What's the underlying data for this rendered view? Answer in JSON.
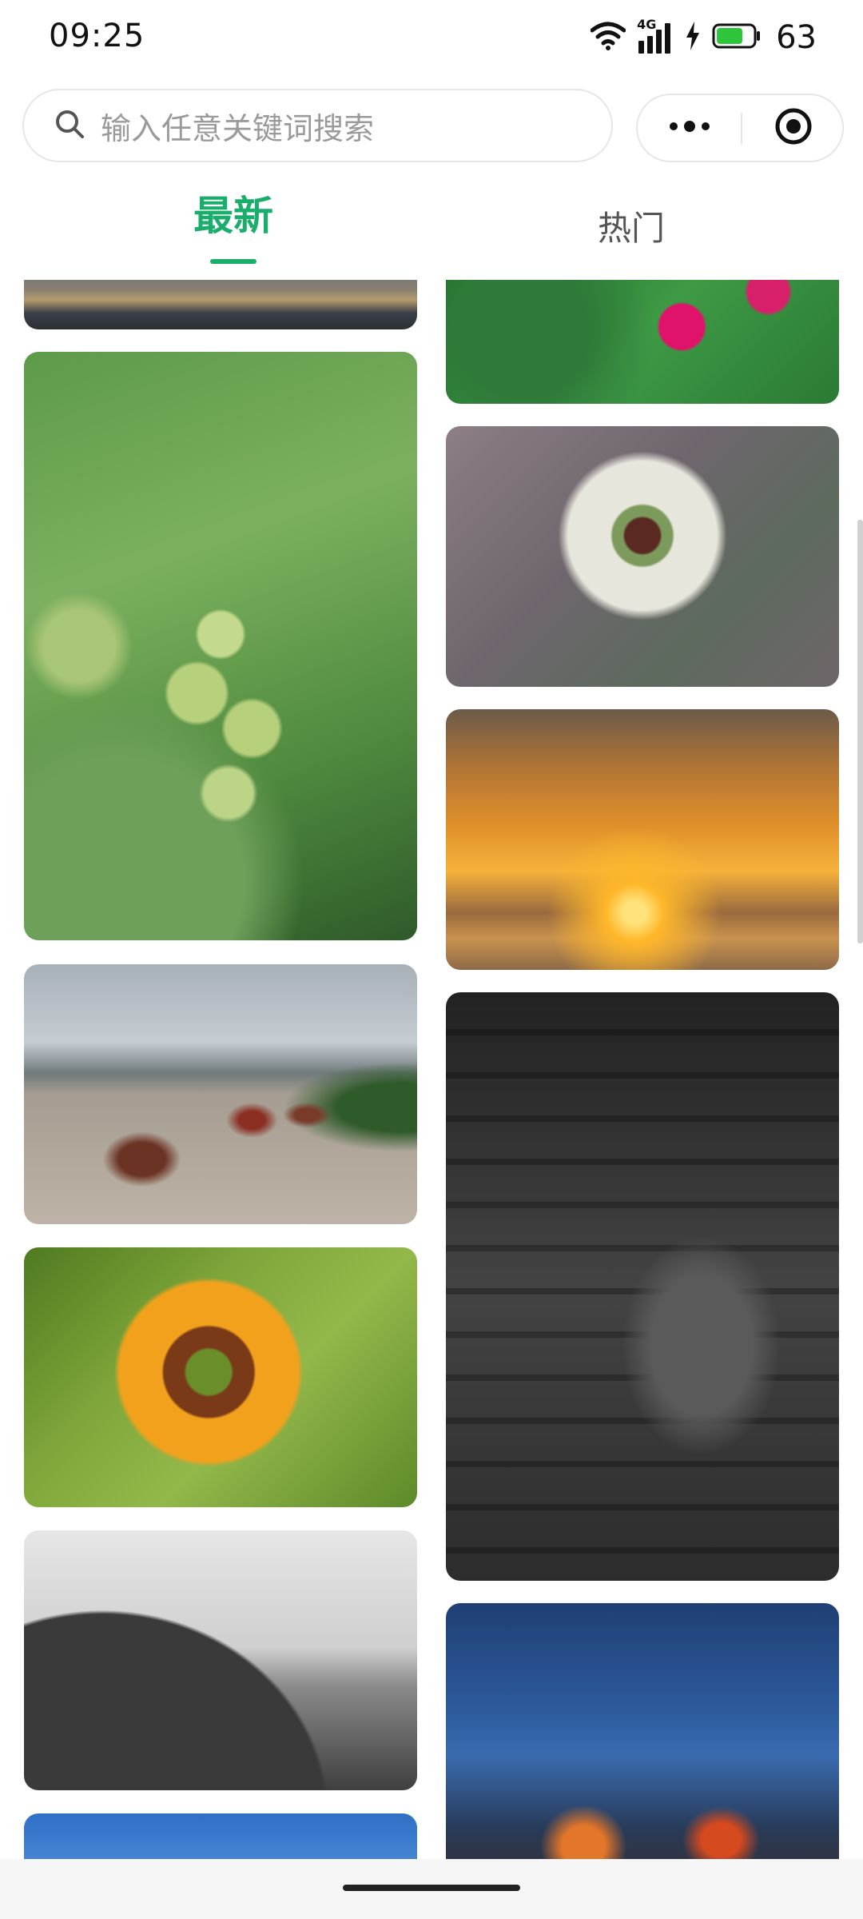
{
  "status_bar": {
    "time": "09:25",
    "network_label": "4G",
    "battery_level": "63",
    "icons": [
      "wifi-icon",
      "cellular-signal-icon",
      "charging-bolt-icon",
      "battery-icon"
    ]
  },
  "search": {
    "placeholder": "输入任意关键词搜索",
    "icon": "search-icon"
  },
  "capsule": {
    "menu_icon": "more-dots-icon",
    "close_icon": "target-close-icon"
  },
  "tabs": [
    {
      "label": "最新",
      "active": true
    },
    {
      "label": "热门",
      "active": false
    }
  ],
  "colors": {
    "accent": "#1aad6c",
    "text_muted": "#9a9a9a",
    "border": "#e6e6e6"
  },
  "feed": {
    "items": [
      {
        "column": "left",
        "subject": "river-at-dusk"
      },
      {
        "column": "left",
        "subject": "green-grapes"
      },
      {
        "column": "left",
        "subject": "boats-on-river"
      },
      {
        "column": "left",
        "subject": "sunflower"
      },
      {
        "column": "left",
        "subject": "birds-on-rail"
      },
      {
        "column": "left",
        "subject": "blue-sky"
      },
      {
        "column": "right",
        "subject": "pink-flower"
      },
      {
        "column": "right",
        "subject": "queen-annes-lace"
      },
      {
        "column": "right",
        "subject": "sunset-over-sea"
      },
      {
        "column": "right",
        "subject": "monochrome-hands"
      },
      {
        "column": "right",
        "subject": "city-night-street"
      }
    ]
  }
}
